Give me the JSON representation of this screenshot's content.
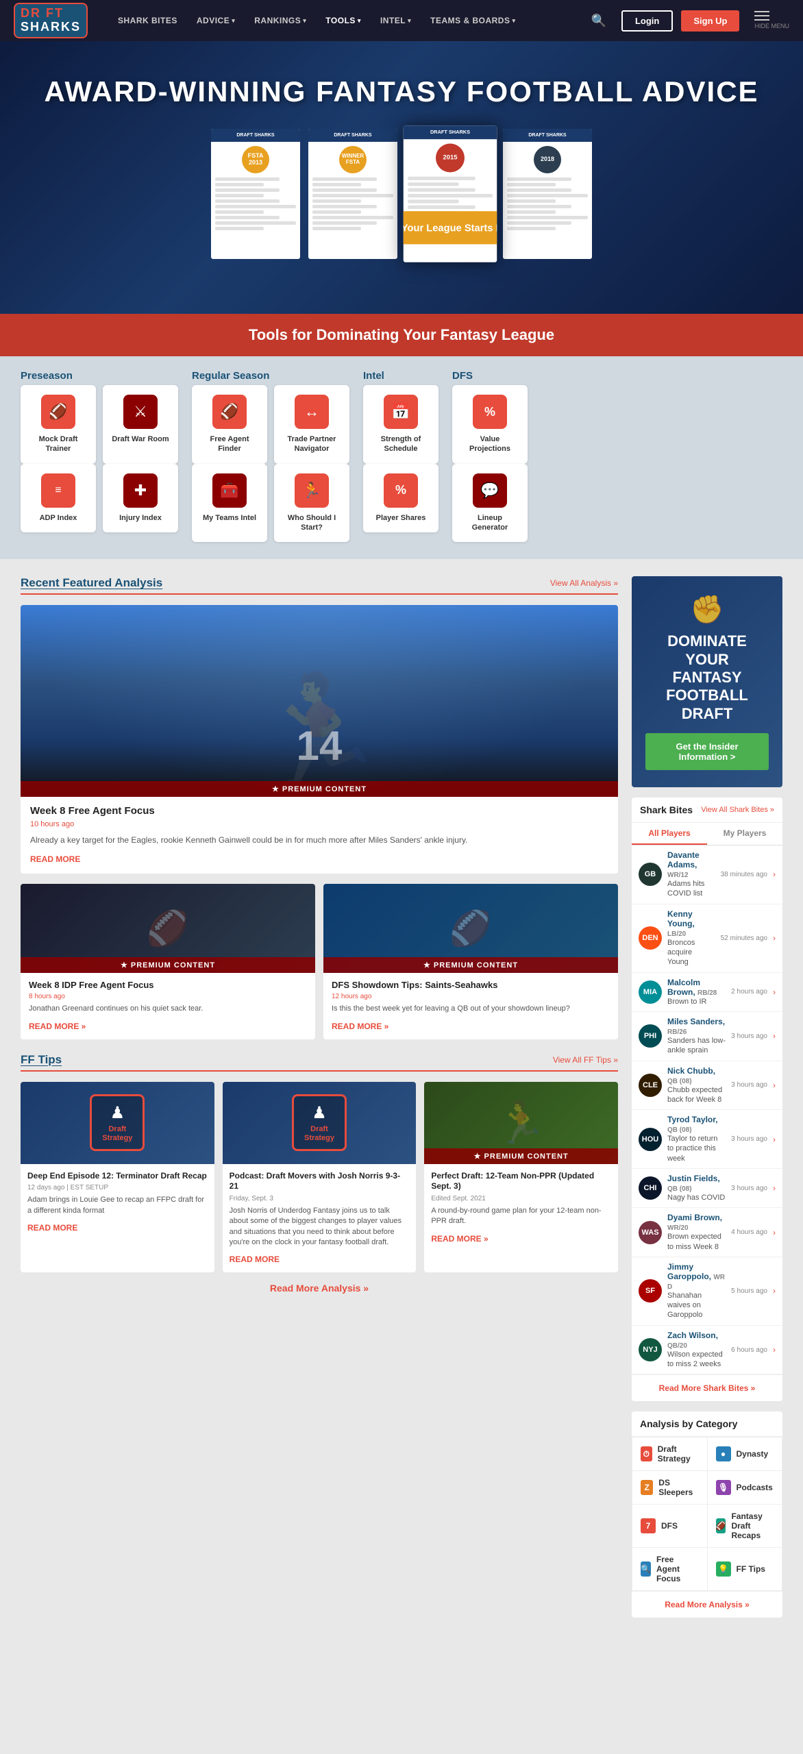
{
  "nav": {
    "logo_top": "DR FT",
    "logo_bot": "SHARKS",
    "items": [
      {
        "label": "SHARK BITES",
        "has_dropdown": false
      },
      {
        "label": "ADVICE",
        "has_dropdown": true
      },
      {
        "label": "RANKINGS",
        "has_dropdown": true
      },
      {
        "label": "TOOLS",
        "has_dropdown": true
      },
      {
        "label": "INTEL",
        "has_dropdown": true
      },
      {
        "label": "TEAMS & BOARDS",
        "has_dropdown": true
      }
    ],
    "login_label": "Login",
    "signup_label": "Sign Up",
    "hide_menu_label": "HIDE MENU"
  },
  "hero": {
    "title": "AWARD-WINNING FANTASY FOOTBALL ADVICE",
    "cta_text": "Winning Your League Starts Here",
    "papers": [
      {
        "year": "2013",
        "award": "FSTA\n2013"
      },
      {
        "year": "2015",
        "award": "WINNER\nFSTA"
      },
      {
        "year": "2015",
        "award": "2015"
      },
      {
        "year": "2018",
        "award": "2018"
      }
    ]
  },
  "tools_section": {
    "banner": "Tools for Dominating Your Fantasy League",
    "categories": [
      {
        "label": "Preseason",
        "tools": [
          {
            "label": "Mock Draft Trainer",
            "icon": "🏈"
          },
          {
            "label": "Draft War Room",
            "icon": "⚔️"
          },
          {
            "label": "ADP Index",
            "icon": "≡"
          },
          {
            "label": "Injury Index",
            "icon": "✚"
          }
        ]
      },
      {
        "label": "Regular Season",
        "tools": [
          {
            "label": "Free Agent Finder",
            "icon": "🏈"
          },
          {
            "label": "Trade Partner Navigator",
            "icon": "↔️"
          },
          {
            "label": "My Teams Intel",
            "icon": "🧰"
          },
          {
            "label": "Who Should I Start?",
            "icon": "🏃"
          }
        ]
      },
      {
        "label": "Intel",
        "tools": [
          {
            "label": "Strength of Schedule",
            "icon": "📅"
          },
          {
            "label": "Player Shares",
            "icon": "%"
          }
        ]
      },
      {
        "label": "DFS",
        "tools": [
          {
            "label": "Value Projections",
            "icon": "%"
          },
          {
            "label": "Lineup Generator",
            "icon": "💬"
          }
        ]
      }
    ]
  },
  "featured_analysis": {
    "section_title": "Recent Featured Analysis",
    "view_all": "View All Analysis »",
    "main_article": {
      "title": "Week 8 Free Agent Focus",
      "time": "10 hours ago",
      "excerpt": "Already a key target for the Eagles, rookie Kenneth Gainwell could be in for much more after Miles Sanders' ankle injury.",
      "read_more": "Read More",
      "premium": true,
      "premium_label": "★ PREMIUM CONTENT"
    },
    "mini_articles": [
      {
        "title": "Week 8 IDP Free Agent Focus",
        "time": "8 hours ago",
        "excerpt": "Jonathan Greenard continues on his quiet sack tear.",
        "read_more": "READ MORE »",
        "premium": true,
        "premium_label": "★ PREMIUM CONTENT"
      },
      {
        "title": "DFS Showdown Tips: Saints-Seahawks",
        "time": "12 hours ago",
        "excerpt": "Is this the best week yet for leaving a QB out of your showdown lineup?",
        "read_more": "READ MORE »",
        "premium": true,
        "premium_label": "★ PREMIUM CONTENT"
      }
    ]
  },
  "ff_tips": {
    "section_title": "FF Tips",
    "view_all": "View All FF Tips »",
    "articles": [
      {
        "title": "Deep End Episode 12: Terminator Draft Recap",
        "meta": "12 days ago | EST SETUP",
        "excerpt": "Adam brings in Louie Gee to recap an FFPC draft for a different kinda format",
        "read_more": "READ MORE",
        "type": "draft_strategy"
      },
      {
        "title": "Podcast: Draft Movers with Josh Norris 9-3-21",
        "meta": "Friday, Sept. 3",
        "excerpt": "Josh Norris of Underdog Fantasy joins us to talk about some of the biggest changes to player values and situations that you need to think about before you're on the clock in your fantasy football draft.",
        "read_more": "READ MORE",
        "type": "draft_strategy"
      },
      {
        "title": "Perfect Draft: 12-Team Non-PPR (Updated Sept. 3)",
        "meta": "Edited Sept. 2021",
        "excerpt": "A round-by-round game plan for your 12-team non-PPR draft.",
        "read_more": "READ MORE »",
        "type": "player",
        "premium": true,
        "premium_label": "★ PREMIUM CONTENT"
      }
    ],
    "read_more_label": "Read More Analysis »"
  },
  "sidebar": {
    "promo": {
      "title_line1": "DOMINATE YOUR",
      "title_line2": "FANTASY FOOTBALL DRAFT",
      "cta": "Get the Insider Information >"
    },
    "shark_bites": {
      "title": "Shark Bites",
      "view_all": "View All Shark Bites »",
      "tabs": [
        "All Players",
        "My Players"
      ],
      "active_tab": "All Players",
      "items": [
        {
          "team_class": "team-gb",
          "team_abbr": "GB",
          "player": "Davante Adams,",
          "team_pos": "WR/12",
          "time": "38 minutes ago",
          "news": "Adams hits COVID list"
        },
        {
          "team_class": "team-den",
          "team_abbr": "DEN",
          "player": "Kenny Young,",
          "team_pos": "LB/20",
          "time": "52 minutes ago",
          "news": "Broncos acquire Young"
        },
        {
          "team_class": "team-mia",
          "team_abbr": "MIA",
          "player": "Malcolm Brown,",
          "team_pos": "RB/28",
          "time": "2 hours ago",
          "news": "Brown to IR"
        },
        {
          "team_class": "team-phi",
          "team_abbr": "PHI",
          "player": "Miles Sanders,",
          "team_pos": "RB/26",
          "time": "3 hours ago",
          "news": "Sanders has low-ankle sprain"
        },
        {
          "team_class": "team-cle",
          "team_abbr": "CLE",
          "player": "Nick Chubb,",
          "team_pos": "QB (08)",
          "time": "3 hours ago",
          "news": "Chubb expected back for Week 8"
        },
        {
          "team_class": "team-hou",
          "team_abbr": "HOU",
          "player": "Tyrod Taylor,",
          "team_pos": "QB (08)",
          "time": "3 hours ago",
          "news": "Taylor to return to practice this week"
        },
        {
          "team_class": "team-chi",
          "team_abbr": "CHI",
          "player": "Justin Fields,",
          "team_pos": "QB (08)",
          "time": "3 hours ago",
          "news": "Nagy has COVID"
        },
        {
          "team_class": "team-was",
          "team_abbr": "WAS",
          "player": "Dyami Brown,",
          "team_pos": "WR/20",
          "time": "4 hours ago",
          "news": "Brown expected to miss Week 8"
        },
        {
          "team_class": "team-sf",
          "team_abbr": "SF",
          "player": "Jimmy Garoppolo,",
          "team_pos": "WR D",
          "time": "5 hours ago",
          "news": "Shanahan waives on Garoppolo"
        },
        {
          "team_class": "team-nyj",
          "team_abbr": "NYJ",
          "player": "Zach Wilson,",
          "team_pos": "QB/20",
          "time": "6 hours ago",
          "news": "Wilson expected to miss 2 weeks"
        }
      ],
      "read_more": "Read More Shark Bites »"
    },
    "analysis_by_category": {
      "title": "Analysis by Category",
      "categories": [
        {
          "label": "Draft Strategy",
          "icon": "⏱",
          "icon_class": "cat-red"
        },
        {
          "label": "Dynasty",
          "icon": "🔴",
          "icon_class": "cat-blue"
        },
        {
          "label": "DS Sleepers",
          "icon": "Z",
          "icon_class": "cat-orange"
        },
        {
          "label": "Podcasts",
          "icon": "🎙",
          "icon_class": "cat-purple"
        },
        {
          "label": "DFS",
          "icon": "7",
          "icon_class": "cat-red"
        },
        {
          "label": "Fantasy Draft Recaps",
          "icon": "🏈",
          "icon_class": "cat-teal"
        },
        {
          "label": "Free Agent Focus",
          "icon": "🔍",
          "icon_class": "cat-blue"
        },
        {
          "label": "FF Tips",
          "icon": "💡",
          "icon_class": "cat-green"
        }
      ],
      "read_more": "Read More Analysis »"
    }
  }
}
